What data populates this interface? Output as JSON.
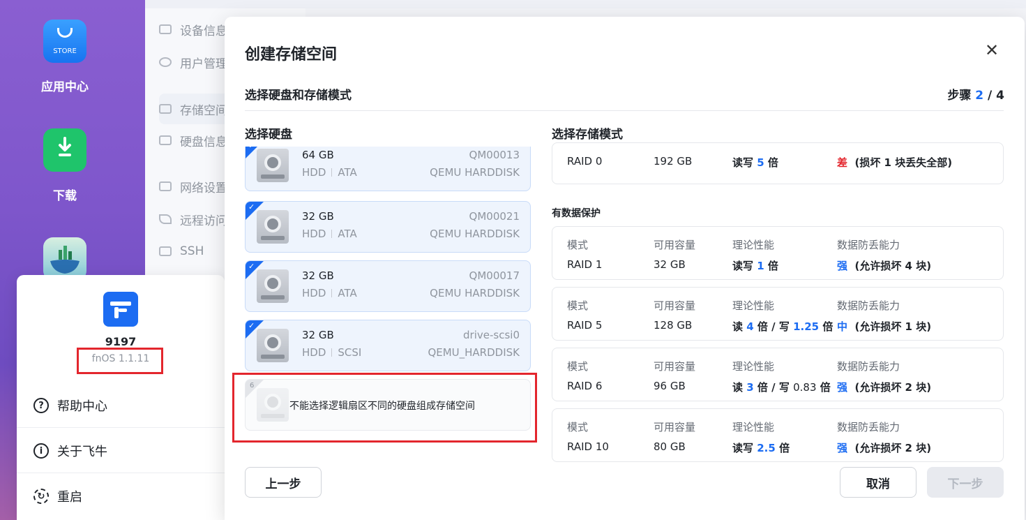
{
  "desktop": {
    "apps": [
      {
        "label": "应用中心",
        "icon_text": "STORE"
      },
      {
        "label": "下载"
      }
    ]
  },
  "settings_nav": [
    {
      "label": "设备信息"
    },
    {
      "label": "用户管理"
    },
    {
      "label": "存储空间"
    },
    {
      "label": "硬盘信息"
    },
    {
      "label": "网络设置"
    },
    {
      "label": "远程访问"
    },
    {
      "label": "SSH"
    }
  ],
  "system_menu": {
    "device_name": "9197",
    "version": "fnOS 1.1.11",
    "items": [
      {
        "label": "帮助中心",
        "icon": "question-icon"
      },
      {
        "label": "关于飞牛",
        "icon": "info-icon"
      },
      {
        "label": "重启",
        "icon": "restart-icon"
      }
    ]
  },
  "dialog": {
    "title": "创建存储空间",
    "close": "✕",
    "subtitle": "选择硬盘和存储模式",
    "step_label": "步骤",
    "step_current": "2",
    "step_sep": "/",
    "step_total": "4",
    "disk_col_title": "选择硬盘",
    "mode_col_title": "选择存储模式",
    "disks": [
      {
        "size": "64 GB",
        "type": "HDD",
        "bus": "ATA",
        "serial": "QM00013",
        "model": "QEMU HARDDISK",
        "selected": true
      },
      {
        "size": "32 GB",
        "type": "HDD",
        "bus": "ATA",
        "serial": "QM00021",
        "model": "QEMU HARDDISK",
        "selected": true
      },
      {
        "size": "32 GB",
        "type": "HDD",
        "bus": "ATA",
        "serial": "QM00017",
        "model": "QEMU HARDDISK",
        "selected": true
      },
      {
        "size": "32 GB",
        "type": "HDD",
        "bus": "SCSI",
        "serial": "drive-scsi0",
        "model": "QEMU_HARDDISK",
        "selected": true
      }
    ],
    "disabled_disk": {
      "index": "6",
      "tooltip": "不能选择逻辑扇区不同的硬盘组成存储空间"
    },
    "raid0": {
      "mode": "RAID 0",
      "capacity": "192 GB",
      "perf_pre": "读写",
      "perf_val": "5",
      "perf_post": "倍",
      "safety_level": "差",
      "safety_note": "(损坏 1 块丢失全部)"
    },
    "protected_label": "有数据保护",
    "headers": {
      "mode": "模式",
      "capacity": "可用容量",
      "perf": "理论性能",
      "safety": "数据防丢能力"
    },
    "raids": [
      {
        "mode": "RAID 1",
        "capacity": "32 GB",
        "perf_a": "读写",
        "perf_a_val": "1",
        "perf_a_post": "倍",
        "perf_b": "",
        "perf_b_val": "",
        "perf_b_post": "",
        "safety_level": "强",
        "safety_note": "(允许损坏 4 块)"
      },
      {
        "mode": "RAID 5",
        "capacity": "128 GB",
        "perf_a": "读",
        "perf_a_val": "4",
        "perf_a_post": "倍 / 写",
        "perf_b_val": "1.25",
        "perf_b_post": "倍",
        "safety_level": "中",
        "safety_note": "(允许损坏 1 块)"
      },
      {
        "mode": "RAID 6",
        "capacity": "96 GB",
        "perf_a": "读",
        "perf_a_val": "3",
        "perf_a_post": "倍 / 写",
        "perf_b_val": "0.83",
        "perf_b_post": "倍",
        "safety_level": "强",
        "safety_note": "(允许损坏 2 块)"
      },
      {
        "mode": "RAID 10",
        "capacity": "80 GB",
        "perf_a": "读写",
        "perf_a_val": "2.5",
        "perf_a_post": "倍",
        "perf_b_val": "",
        "perf_b_post": "",
        "safety_level": "强",
        "safety_note": "(允许损坏 2 块)"
      }
    ],
    "buttons": {
      "prev": "上一步",
      "cancel": "取消",
      "next": "下一步"
    }
  },
  "colors": {
    "accent": "#1c6cf2",
    "danger": "#e3262d",
    "highlight_box": "#e3262d"
  }
}
